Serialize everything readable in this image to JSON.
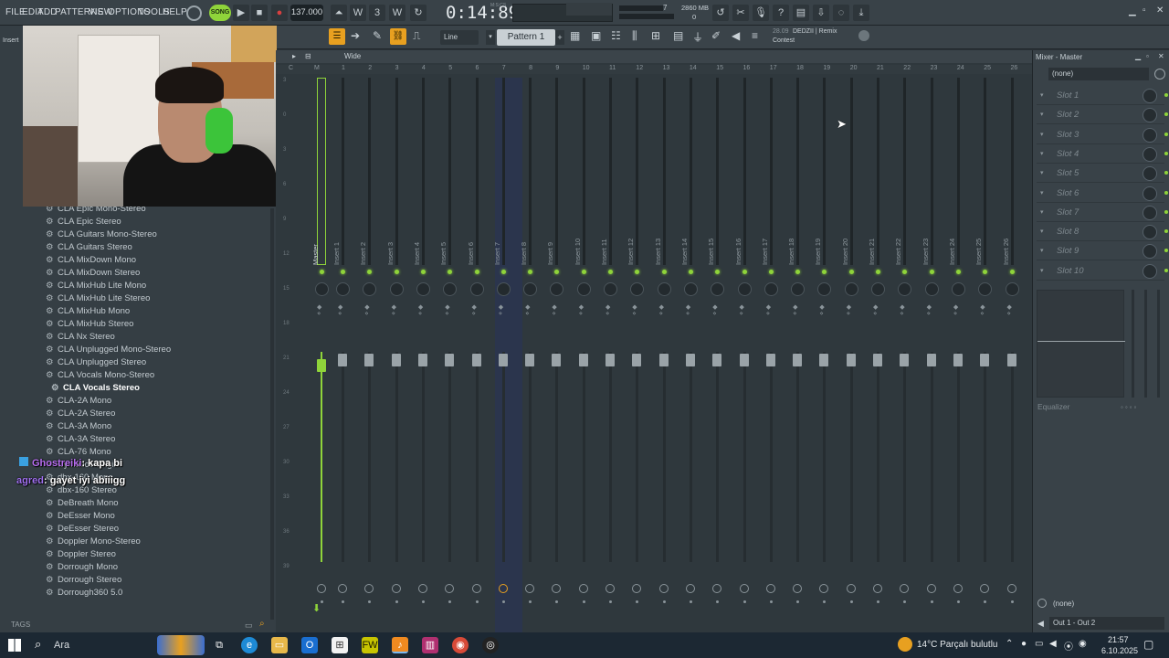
{
  "menu": [
    "FILE",
    "EDIT",
    "ADD",
    "PATTERNS",
    "VIEW",
    "OPTIONS",
    "TOOLS",
    "HELP"
  ],
  "transport": {
    "mode": "SONG",
    "tempo": "137.000",
    "time": "0:14:89",
    "time_unit": "M:S:CS",
    "cpu_value": "7",
    "memory": "2860 MB",
    "poly": "0"
  },
  "toolbar2": {
    "snap": "Line",
    "pattern": "Pattern 1",
    "hint_time": "28.09",
    "hint_title": "DEDZII | Remix",
    "hint_sub": "Contest"
  },
  "browser": {
    "header_small": "Insert",
    "items": [
      "CLA Epic Mono-Stereo",
      "CLA Epic Stereo",
      "CLA Guitars Mono-Stereo",
      "CLA Guitars Stereo",
      "CLA MixDown Mono",
      "CLA MixDown Stereo",
      "CLA MixHub Lite Mono",
      "CLA MixHub Lite Stereo",
      "CLA MixHub Mono",
      "CLA MixHub Stereo",
      "CLA Nx Stereo",
      "CLA Unplugged Mono-Stereo",
      "CLA Unplugged Stereo",
      "CLA Vocals Mono-Stereo",
      "CLA Vocals Stereo",
      "CLA-2A Mono",
      "CLA-2A Stereo",
      "CLA-3A Mono",
      "CLA-3A Stereo",
      "CLA-76 Mono",
      "Cymatics Origin",
      "dbx-160 Mono",
      "dbx-160 Stereo",
      "DeBreath Mono",
      "DeEsser Mono",
      "DeEsser Stereo",
      "Doppler Mono-Stereo",
      "Doppler Stereo",
      "Dorrough Mono",
      "Dorrough Stereo",
      "Dorrough360 5.0"
    ],
    "selected_index": 14,
    "tags_label": "TAGS"
  },
  "chat": [
    {
      "user": "Ghostreiki",
      "message": "kapa bi"
    },
    {
      "user": "agred",
      "message": "gayet iyi abiiigg"
    }
  ],
  "mixer": {
    "title": "Mixer - Master",
    "view": "Wide",
    "master_label": "Master",
    "inserts": [
      "Insert 1",
      "Insert 2",
      "Insert 3",
      "Insert 4",
      "Insert 5",
      "Insert 6",
      "Insert 7",
      "Insert 8",
      "Insert 9",
      "Insert 10",
      "Insert 11",
      "Insert 12",
      "Insert 13",
      "Insert 14",
      "Insert 15",
      "Insert 16",
      "Insert 17",
      "Insert 18",
      "Insert 19",
      "Insert 20",
      "Insert 21",
      "Insert 22",
      "Insert 23",
      "Insert 24",
      "Insert 25",
      "Insert 26"
    ],
    "columns": [
      "C",
      "M",
      "1",
      "2",
      "3",
      "4",
      "5",
      "6",
      "7",
      "8",
      "9",
      "10",
      "11",
      "12",
      "13",
      "14",
      "15",
      "16",
      "17",
      "18",
      "19",
      "20",
      "21",
      "22",
      "23",
      "24",
      "25",
      "26"
    ],
    "db_scale": [
      "3",
      "0",
      "3",
      "6",
      "9",
      "12",
      "15",
      "18",
      "21",
      "24",
      "27",
      "30",
      "33",
      "36",
      "39"
    ],
    "selected_insert": 7
  },
  "mixer_panel": {
    "preset": "(none)",
    "slots": [
      "Slot 1",
      "Slot 2",
      "Slot 3",
      "Slot 4",
      "Slot 5",
      "Slot 6",
      "Slot 7",
      "Slot 8",
      "Slot 9",
      "Slot 10"
    ],
    "equalizer_label": "Equalizer",
    "out_preset": "(none)",
    "output": "Out 1 - Out 2"
  },
  "taskbar": {
    "search": "Ara",
    "weather": "14°C  Parçalı bulutlu",
    "time": "21:57",
    "date": "6.10.2025"
  },
  "colors": {
    "accent_green": "#8fd43a",
    "accent_orange": "#e8a020",
    "record_red": "#d84040",
    "selected_strip": "#2a3550"
  }
}
